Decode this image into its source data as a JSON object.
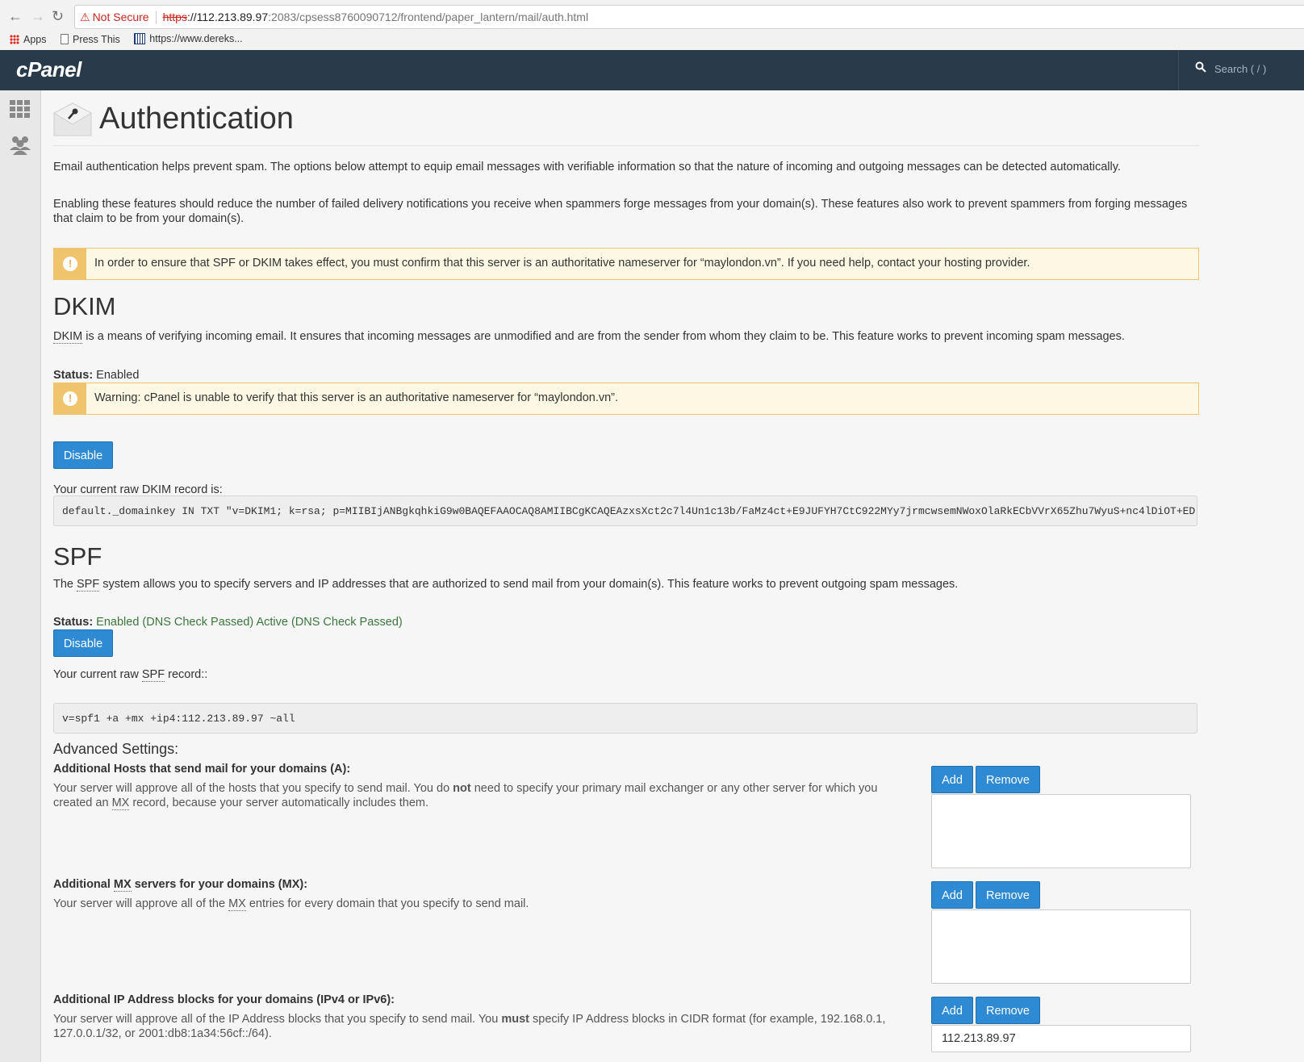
{
  "browser": {
    "security_label": "Not Secure",
    "url_scheme": "https",
    "url_host": "://112.213.89.97",
    "url_path": ":2083/cpsess8760090712/frontend/paper_lantern/mail/auth.html",
    "bookmarks": [
      {
        "label": "Apps",
        "icon": "apps-grid-icon"
      },
      {
        "label": "Press This",
        "icon": "page-icon"
      },
      {
        "label": "https://www.dereks...",
        "icon": "site-favicon-icon"
      }
    ]
  },
  "header": {
    "logo": "cPanel",
    "search_placeholder": "Search ( / )"
  },
  "page": {
    "title": "Authentication",
    "intro_1": "Email authentication helps prevent spam. The options below attempt to equip email messages with verifiable information so that the nature of incoming and outgoing messages can be detected automatically.",
    "intro_2": "Enabling these features should reduce the number of failed delivery notifications you receive when spammers forge messages from your domain(s). These features also work to prevent spammers from forging messages that claim to be from your domain(s).",
    "nameserver_alert": "In order to ensure that SPF or DKIM takes effect, you must confirm that this server is an authoritative nameserver for “maylondon.vn”. If you need help, contact your hosting provider."
  },
  "dkim": {
    "heading": "DKIM",
    "abbr": "DKIM",
    "description": " is a means of verifying incoming email. It ensures that incoming messages are unmodified and are from the sender from whom they claim to be. This feature works to prevent incoming spam messages.",
    "status_label": "Status:",
    "status_value": " Enabled",
    "warning": "Warning: cPanel is unable to verify that this server is an authoritative nameserver for “maylondon.vn”.",
    "disable_label": "Disable",
    "record_label": "Your current raw DKIM record is:",
    "record_value": "default._domainkey IN TXT \"v=DKIM1; k=rsa; p=MIIBIjANBgkqhkiG9w0BAQEFAAOCAQ8AMIIBCgKCAQEAzxsXct2c7l4Un1c13b/FaMz4ct+E9JUFYH7CtC922MYy7jrmcwsemNWoxOlaRkECbVVrX65Zhu7WyuS+nc4lDiOT+ED"
  },
  "spf": {
    "heading": "SPF",
    "desc_pre": "The ",
    "abbr": "SPF",
    "desc_post": " system allows you to specify servers and IP addresses that are authorized to send mail from your domain(s). This feature works to prevent outgoing spam messages.",
    "status_label": "Status:",
    "status_value": " Enabled (DNS Check Passed) Active (DNS Check Passed)",
    "disable_label": "Disable",
    "record_label_pre": "Your current raw ",
    "record_label_abbr": "SPF",
    "record_label_post": " record::",
    "record_value": "v=spf1 +a +mx +ip4:112.213.89.97 ~all"
  },
  "advanced": {
    "heading": "Advanced Settings:",
    "add_label": "Add",
    "remove_label": "Remove",
    "hosts": {
      "title": "Additional Hosts that send mail for your domains (A):",
      "desc_1": "Your server will approve all of the hosts that you specify to send mail. You do ",
      "desc_bold": "not",
      "desc_2": " need to specify your primary mail exchanger or any other server for which you created an ",
      "desc_abbr": "MX",
      "desc_3": " record, because your server automatically includes them."
    },
    "mx": {
      "title_1": "Additional ",
      "title_abbr": "MX",
      "title_2": " servers for your domains (MX):",
      "desc_1": "Your server will approve all of the ",
      "desc_abbr": "MX",
      "desc_2": " entries for every domain that you specify to send mail."
    },
    "ip": {
      "title": "Additional IP Address blocks for your domains (IPv4 or IPv6):",
      "desc_1": "Your server will approve all of the IP Address blocks that you specify to send mail. You ",
      "desc_bold": "must",
      "desc_2": " specify IP Address blocks in CIDR format (for example, 192.168.0.1, 127.0.0.1/32, or 2001:db8:1a34:56cf::/64).",
      "entries": [
        "112.213.89.97"
      ]
    }
  },
  "colors": {
    "topbar": "#293a4a",
    "primary_button": "#2d8ad3",
    "alert_bg": "#fcf8e3",
    "alert_border": "#f0c36d",
    "status_green": "#3c763d"
  }
}
